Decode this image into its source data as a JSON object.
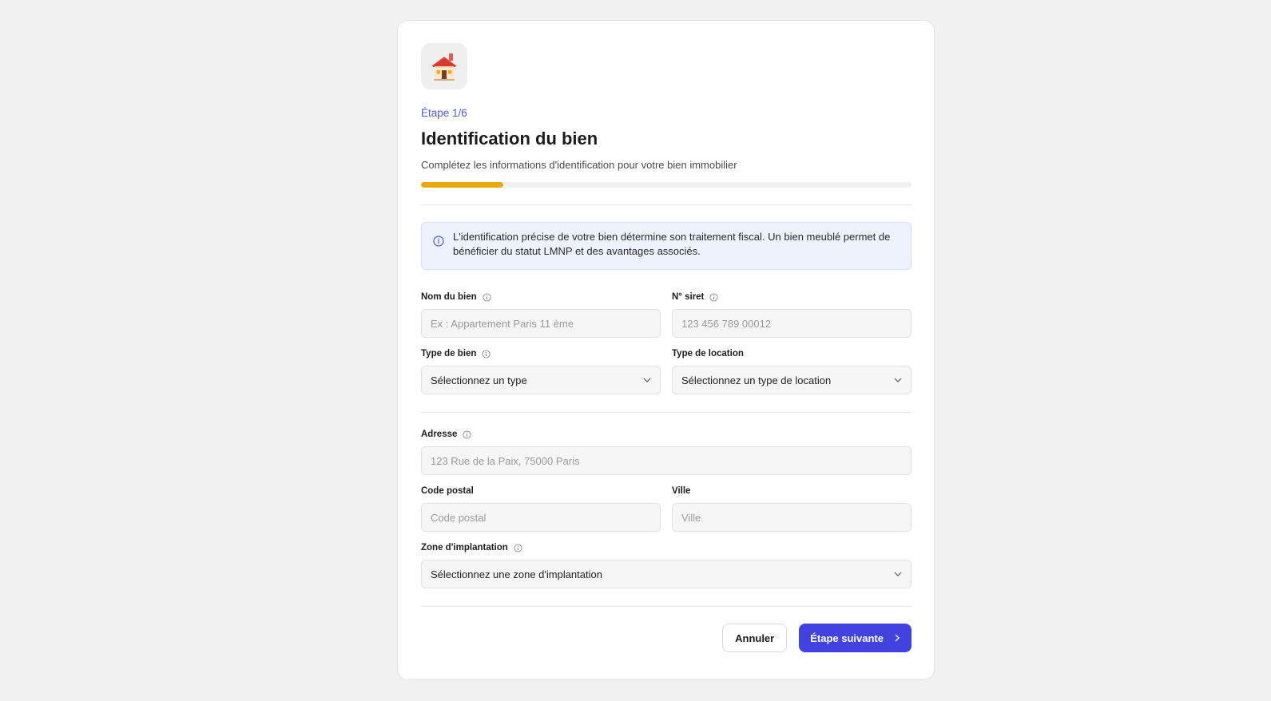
{
  "header": {
    "step": "Étape 1/6",
    "title": "Identification du bien",
    "subtitle": "Complétez les informations d'identification pour votre bien immobilier",
    "progress_percent": 16.7,
    "logo_icon": "house-icon"
  },
  "info": {
    "icon": "info-circle-icon",
    "text": "L'identification précise de votre bien détermine son traitement fiscal. Un bien meublé permet de bénéficier du statut LMNP et des avantages associés."
  },
  "fields": {
    "nom_bien": {
      "label": "Nom du bien",
      "placeholder": "Ex : Appartement Paris 11 ème"
    },
    "siret": {
      "label": "N° siret",
      "placeholder": "123 456 789 00012"
    },
    "type_bien": {
      "label": "Type de bien",
      "value": "Sélectionnez un type"
    },
    "type_location": {
      "label": "Type de location",
      "value": "Sélectionnez un type de location"
    },
    "adresse": {
      "label": "Adresse",
      "placeholder": "123 Rue de la Paix, 75000 Paris"
    },
    "code_postal": {
      "label": "Code postal",
      "placeholder": "Code postal"
    },
    "ville": {
      "label": "Ville",
      "placeholder": "Ville"
    },
    "zone": {
      "label": "Zone d'implantation",
      "value": "Sélectionnez une zone d'implantation"
    }
  },
  "actions": {
    "cancel_label": "Annuler",
    "next_label": "Étape suivante"
  },
  "colors": {
    "accent": "#4043e0",
    "step_text": "#4f5bd5",
    "progress": "#e9a80d",
    "info_bg": "#edf2fd"
  }
}
